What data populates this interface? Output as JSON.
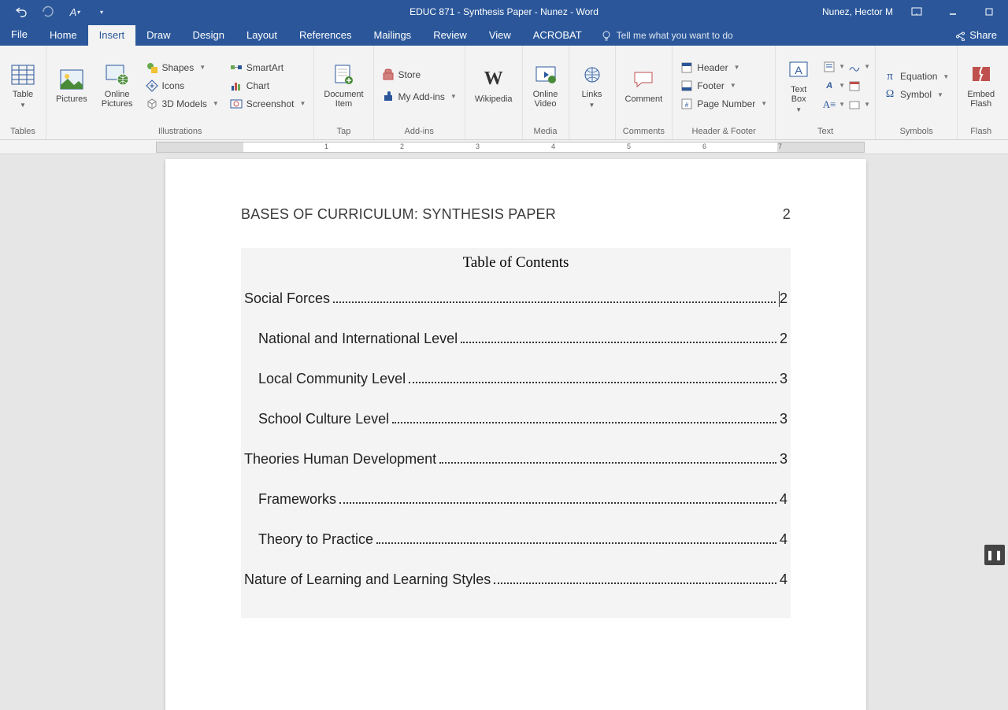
{
  "titlebar": {
    "doc_title": "EDUC 871 - Synthesis Paper - Nunez  -  Word",
    "user": "Nunez, Hector M"
  },
  "tabs": {
    "file": "File",
    "items": [
      "Home",
      "Insert",
      "Draw",
      "Design",
      "Layout",
      "References",
      "Mailings",
      "Review",
      "View",
      "ACROBAT"
    ],
    "active_index": 1,
    "tellme": "Tell me what you want to do",
    "share": "Share"
  },
  "ribbon": {
    "tables": {
      "label": "Tables",
      "btn": "Table"
    },
    "illustrations": {
      "label": "Illustrations",
      "pictures": "Pictures",
      "online_pictures": "Online\nPictures",
      "shapes": "Shapes",
      "icons": "Icons",
      "models": "3D Models",
      "smartart": "SmartArt",
      "chart": "Chart",
      "screenshot": "Screenshot"
    },
    "tap": {
      "label": "Tap",
      "btn": "Document\nItem"
    },
    "addins": {
      "label": "Add-ins",
      "store": "Store",
      "my": "My Add-ins"
    },
    "wikipedia": "Wikipedia",
    "media": {
      "label": "Media",
      "btn": "Online\nVideo"
    },
    "links": {
      "label": "",
      "btn": "Links"
    },
    "comments": {
      "label": "Comments",
      "btn": "Comment"
    },
    "headerfooter": {
      "label": "Header & Footer",
      "header": "Header",
      "footer": "Footer",
      "pagenum": "Page Number"
    },
    "text": {
      "label": "Text",
      "textbox": "Text\nBox"
    },
    "symbols": {
      "label": "Symbols",
      "equation": "Equation",
      "symbol": "Symbol"
    },
    "flash": {
      "label": "Flash",
      "btn": "Embed\nFlash"
    }
  },
  "document": {
    "running_head": "BASES OF CURRICULUM: SYNTHESIS PAPER",
    "page_no": "2",
    "toc_title": "Table of Contents",
    "toc": [
      {
        "title": "Social Forces",
        "page": "2",
        "indent": false,
        "cursor_before_page": true
      },
      {
        "title": "National and International Level",
        "page": "2",
        "indent": true
      },
      {
        "title": "Local Community Level",
        "page": "3",
        "indent": true
      },
      {
        "title": "School Culture Level",
        "page": "3",
        "indent": true
      },
      {
        "title": "Theories Human Development",
        "page": "3",
        "indent": false
      },
      {
        "title": "Frameworks",
        "page": "4",
        "indent": true
      },
      {
        "title": "Theory to Practice",
        "page": "4",
        "indent": true
      },
      {
        "title": "Nature of Learning and Learning Styles",
        "page": "4",
        "indent": false
      }
    ]
  },
  "ruler_numbers": [
    "1",
    "2",
    "3",
    "4",
    "5",
    "6",
    "7"
  ]
}
